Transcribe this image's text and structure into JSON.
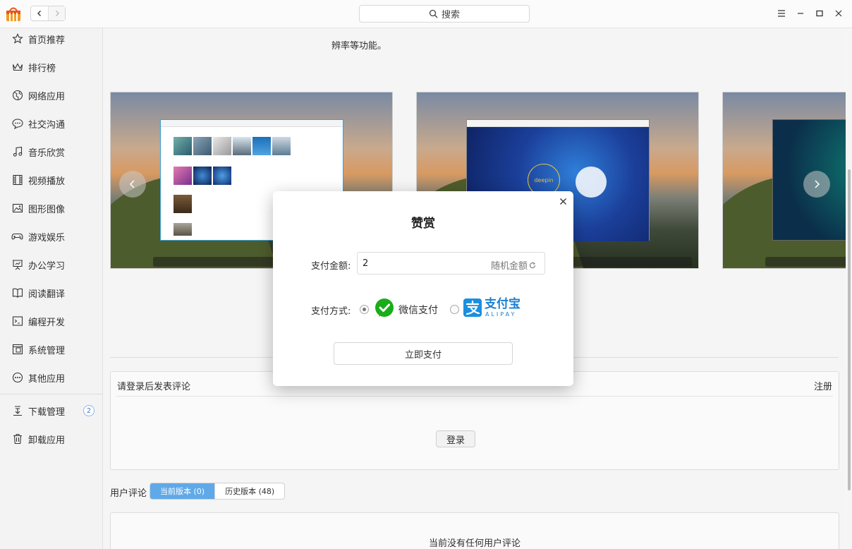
{
  "search": {
    "placeholder": "搜索"
  },
  "sidebar": {
    "items": [
      {
        "label": "首页推荐",
        "icon": "star-icon"
      },
      {
        "label": "排行榜",
        "icon": "crown-icon"
      },
      {
        "label": "网络应用",
        "icon": "globe-icon"
      },
      {
        "label": "社交沟通",
        "icon": "chat-icon"
      },
      {
        "label": "音乐欣赏",
        "icon": "music-icon"
      },
      {
        "label": "视频播放",
        "icon": "film-icon"
      },
      {
        "label": "图形图像",
        "icon": "image-icon"
      },
      {
        "label": "游戏娱乐",
        "icon": "gamepad-icon"
      },
      {
        "label": "办公学习",
        "icon": "presentation-icon"
      },
      {
        "label": "阅读翻译",
        "icon": "book-icon"
      },
      {
        "label": "编程开发",
        "icon": "terminal-icon"
      },
      {
        "label": "系统管理",
        "icon": "system-icon"
      },
      {
        "label": "其他应用",
        "icon": "more-icon"
      }
    ],
    "download": {
      "label": "下载管理",
      "badge": "2",
      "icon": "download-icon"
    },
    "uninstall": {
      "label": "卸载应用",
      "icon": "trash-icon"
    }
  },
  "main": {
    "description_tail": "辨率等功能。",
    "comment_prompt": "请登录后发表评论",
    "register": "注册",
    "login": "登录",
    "reviews_label": "用户评论",
    "tabs": [
      {
        "label": "当前版本 (0)",
        "active": true
      },
      {
        "label": "历史版本 (48)",
        "active": false
      }
    ],
    "no_reviews": "当前没有任何用户评论",
    "screenshot_overlay_text": "deepin"
  },
  "dialog": {
    "title": "赞赏",
    "amount_label": "支付金额:",
    "amount_value": "2",
    "random_amount": "随机金额",
    "method_label": "支付方式:",
    "wechat_label": "微信支付",
    "alipay_label": "支付宝",
    "alipay_sub": "ALIPAY",
    "pay_button": "立即支付",
    "selected_method": "wechat"
  },
  "colors": {
    "accent": "#5fa9e8",
    "wechat_green": "#1aad19",
    "alipay_blue": "#1a7fd0"
  }
}
